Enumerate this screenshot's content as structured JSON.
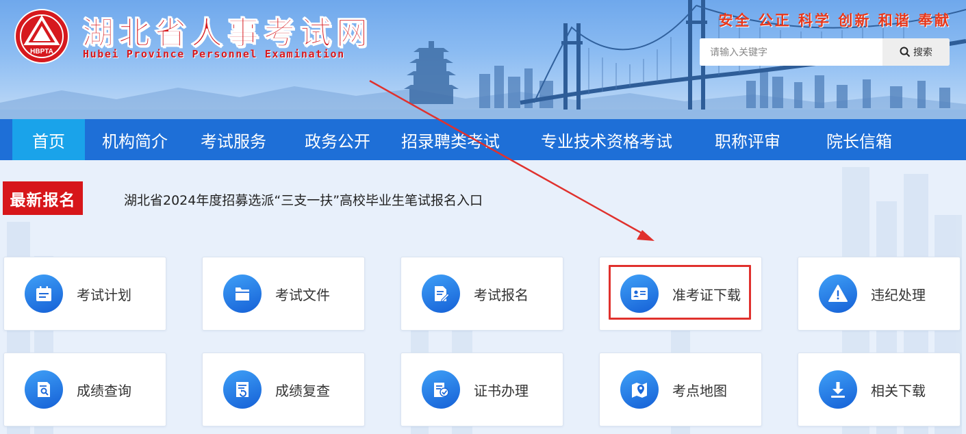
{
  "header": {
    "seal_text": "HBPTA",
    "title": "湖北省人事考试网",
    "subtitle": "Hubei Province Personnel Examination",
    "slogan": "安全 公正 科学 创新 和谐 奉献"
  },
  "search": {
    "placeholder": "请输入关键字",
    "value": "",
    "button_label": "搜索",
    "icon": "search-icon"
  },
  "nav": {
    "items": [
      {
        "label": "首页",
        "active": true
      },
      {
        "label": "机构简介"
      },
      {
        "label": "考试服务"
      },
      {
        "label": "政务公开"
      },
      {
        "label": "招录聘类考试"
      },
      {
        "label": "专业技术资格考试"
      },
      {
        "label": "职称评审"
      },
      {
        "label": "院长信箱"
      }
    ]
  },
  "notice": {
    "tag": "最新报名",
    "text": "湖北省2024年度招募选派“三支一扶”高校毕业生笔试报名入口"
  },
  "services": [
    {
      "label": "考试计划",
      "icon": "calendar-icon"
    },
    {
      "label": "考试文件",
      "icon": "folder-icon"
    },
    {
      "label": "考试报名",
      "icon": "document-edit-icon"
    },
    {
      "label": "准考证下载",
      "icon": "id-card-icon",
      "highlighted": true
    },
    {
      "label": "违纪处理",
      "icon": "warning-icon"
    },
    {
      "label": "成绩查询",
      "icon": "document-search-icon"
    },
    {
      "label": "成绩复查",
      "icon": "document-recheck-icon"
    },
    {
      "label": "证书办理",
      "icon": "certificate-icon"
    },
    {
      "label": "考点地图",
      "icon": "map-pin-icon"
    },
    {
      "label": "相关下载",
      "icon": "download-icon"
    }
  ],
  "colors": {
    "nav_background": "#1e6fd7",
    "nav_active": "#1aa3ea",
    "title_red": "#d6191e",
    "notice_red": "#d7161a",
    "highlight_red": "#e0312d"
  }
}
